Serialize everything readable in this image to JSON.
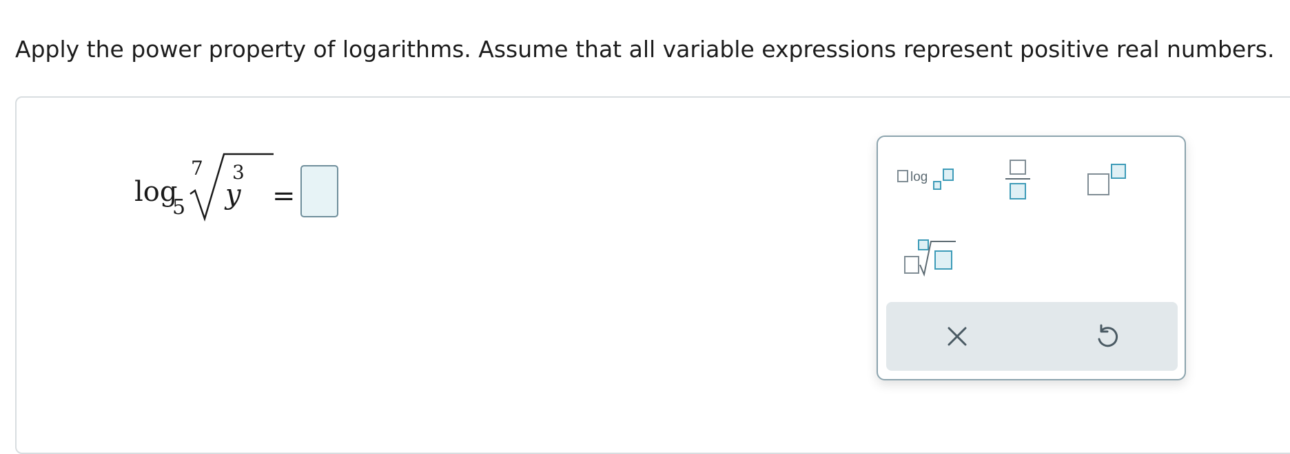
{
  "instructions": "Apply the power property of logarithms. Assume that all variable expressions represent positive real numbers.",
  "expression": {
    "log_label": "log",
    "log_base": "5",
    "root_index": "7",
    "radicand": "y",
    "exponent": "3",
    "equals": "="
  },
  "answer": {
    "value": ""
  },
  "keypad": {
    "keys": [
      {
        "name": "log-template",
        "label": "log"
      },
      {
        "name": "fraction-template"
      },
      {
        "name": "exponent-template"
      },
      {
        "name": "nth-root-template"
      }
    ],
    "clear_icon": "close-icon",
    "undo_icon": "undo-icon"
  },
  "colors": {
    "accent": "#3d9bb8",
    "accent_fill": "#dff0f5",
    "outline_grey": "#7f8c94",
    "answer_box_fill": "#e7f3f6",
    "keypad_bar": "#e2e8eb"
  }
}
